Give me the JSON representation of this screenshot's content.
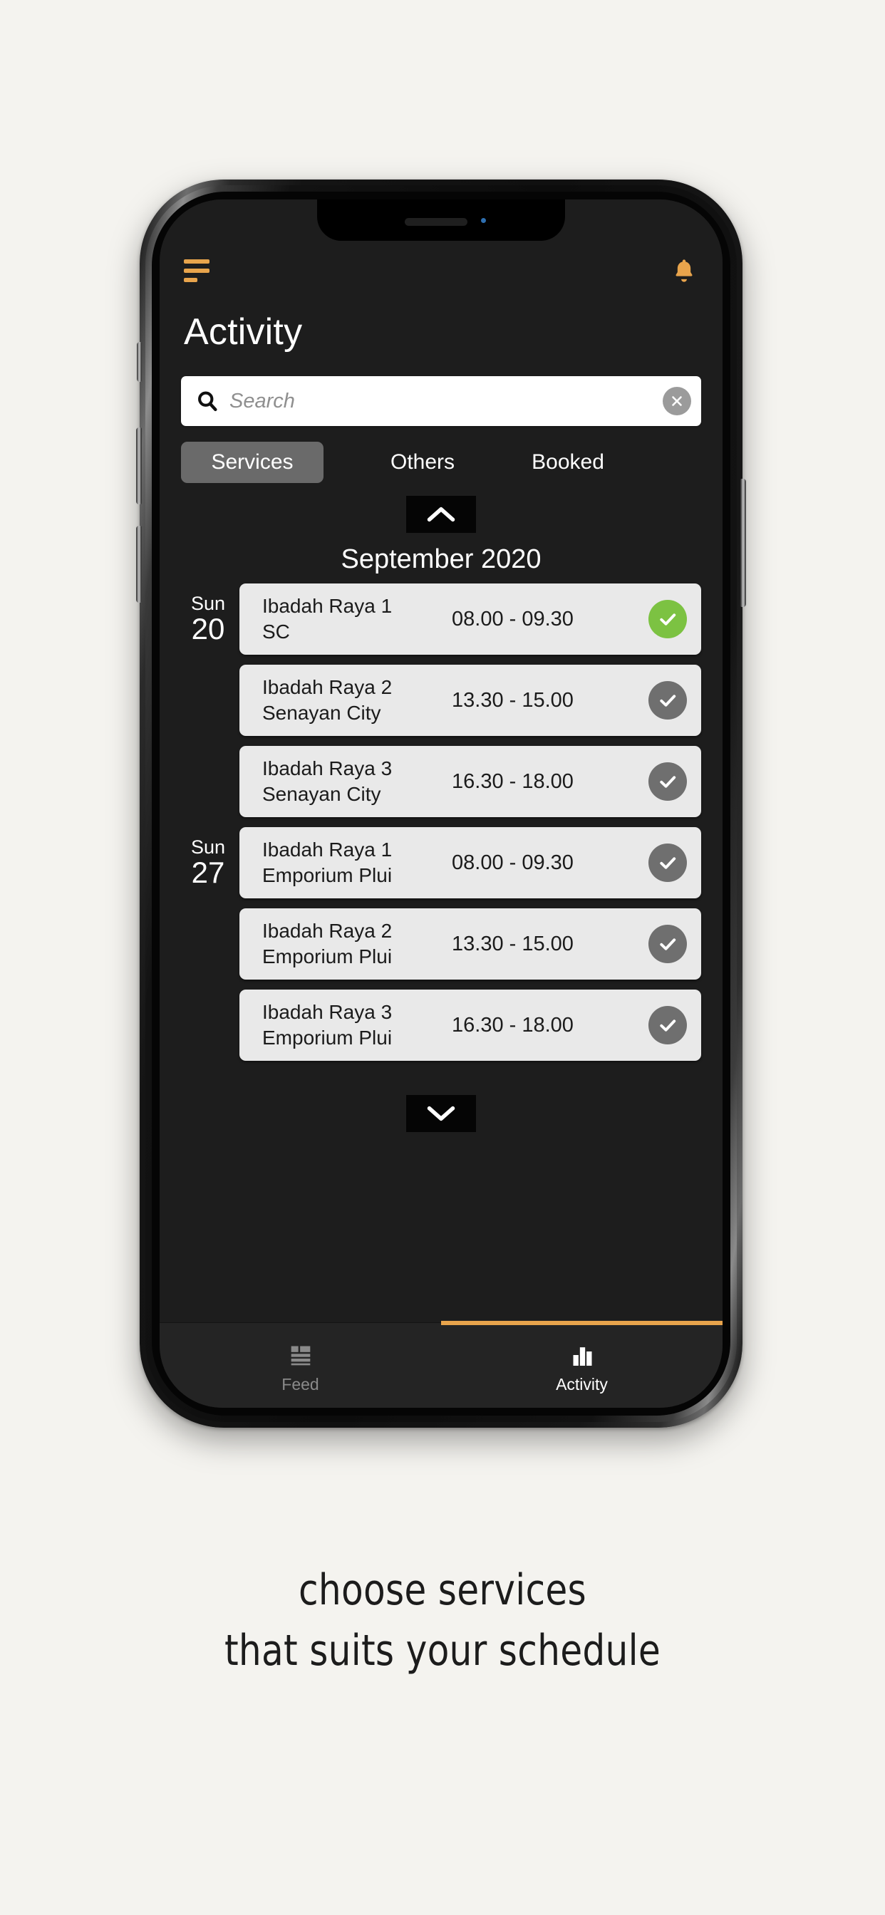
{
  "header": {
    "menu_icon": "hamburger-icon",
    "bell_icon": "bell-icon",
    "title": "Activity"
  },
  "search": {
    "icon": "search-icon",
    "placeholder": "Search",
    "value": "",
    "clear_icon": "close-circle-icon"
  },
  "tabs": [
    {
      "label": "Services",
      "active": true
    },
    {
      "label": "Others",
      "active": false
    },
    {
      "label": "Booked",
      "active": false
    }
  ],
  "scroll": {
    "up_icon": "chevron-up-icon",
    "down_icon": "chevron-down-icon"
  },
  "schedule": {
    "month": "September 2020",
    "groups": [
      {
        "dow": "Sun",
        "day": "20",
        "items": [
          {
            "title": "Ibadah Raya 1",
            "location": "SC",
            "time": "08.00 - 09.30",
            "checked": true
          },
          {
            "title": "Ibadah Raya 2",
            "location": "Senayan City",
            "time": "13.30 - 15.00",
            "checked": false
          },
          {
            "title": "Ibadah Raya 3",
            "location": "Senayan City",
            "time": "16.30 - 18.00",
            "checked": false
          }
        ]
      },
      {
        "dow": "Sun",
        "day": "27",
        "items": [
          {
            "title": "Ibadah Raya 1",
            "location": "Emporium Plui",
            "time": "08.00 - 09.30",
            "checked": false
          },
          {
            "title": "Ibadah Raya 2",
            "location": "Emporium Plui",
            "time": "13.30 - 15.00",
            "checked": false
          },
          {
            "title": "Ibadah Raya 3",
            "location": "Emporium Plui",
            "time": "16.30 - 18.00",
            "checked": false
          }
        ]
      }
    ]
  },
  "bottomnav": {
    "items": [
      {
        "label": "Feed",
        "icon": "feed-list-icon",
        "active": false
      },
      {
        "label": "Activity",
        "icon": "bar-chart-icon",
        "active": true
      }
    ]
  },
  "caption": {
    "line1": "choose services",
    "line2": "that suits your schedule"
  },
  "colors": {
    "accent": "#e8a44c",
    "screen_bg": "#1d1d1d",
    "card_bg": "#e9e9e9",
    "check_on": "#7cc242",
    "check_off": "#6f6f6f",
    "page_bg": "#f4f3ef"
  }
}
